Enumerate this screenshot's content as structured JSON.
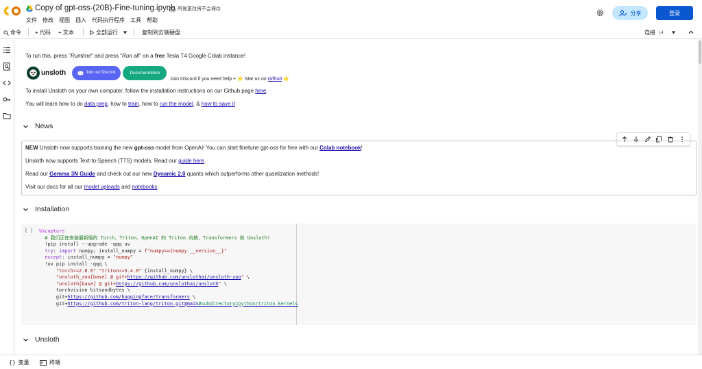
{
  "header": {
    "title": "Copy of gpt-oss-(20B)-Fine-tuning.ipynb",
    "save_note": "所做更改将不会保存",
    "menus": [
      "文件",
      "修改",
      "视图",
      "插入",
      "代码执行程序",
      "工具",
      "帮助"
    ],
    "share_label": "分享",
    "login_label": "登录"
  },
  "toolbar": {
    "command": "命令",
    "add_code": "+ 代码",
    "add_text": "+ 文本",
    "run_all": "全部运行",
    "copy_drive": "复制到云端硬盘",
    "connect": "连接",
    "runtime": "L4"
  },
  "intro": {
    "line1_pre": "To run this, press \"",
    "line1_runtime": "Runtime",
    "line1_mid": "\" and press \"",
    "line1_runall": "Run all",
    "line1_mid2": "\" on a ",
    "line1_free": "free",
    "line1_post": " Tesla T4 Google Colab instance!",
    "unsloth_logo": "unsloth",
    "discord_label": "Join our Discord",
    "docs_label": "Documentation",
    "join_pre": "Join Discord if you need help + ⭐ ",
    "star_text": "Star us on ",
    "github_link": "Github",
    "join_post": " ⭐",
    "install_pre": "To install Unsloth on your own computer, follow the installation instructions on our Github page ",
    "install_link": "here",
    "install_post": ".",
    "learn_pre": "You will learn how to do ",
    "learn_link1": "data prep",
    "learn_sep1": ", how to ",
    "learn_link2": "train",
    "learn_sep2": ", how to ",
    "learn_link3": "run the model",
    "learn_sep3": ", & ",
    "learn_link4": "how to save it"
  },
  "news": {
    "heading": "News",
    "l1_new": "NEW",
    "l1_a": " Unsloth now supports training the new ",
    "l1_model": "gpt-oss",
    "l1_b": " model from OpenAI! You can start finetune gpt-oss for free with our ",
    "l1_link": "Colab notebook",
    "l1_c": "!",
    "l2_a": "Unsloth now supports Text-to-Speech (TTS) models. Read our ",
    "l2_link": "guide here",
    "l2_b": ".",
    "l3_a": "Read our ",
    "l3_link1": "Gemma 3N Guide",
    "l3_b": " and check out our new ",
    "l3_link2": "Dynamic 2.0",
    "l3_c": " quants which outperforms other quantization methods!",
    "l4_a": "Visit our docs for all our ",
    "l4_link1": "model uploads",
    "l4_b": " and ",
    "l4_link2": "notebooks",
    "l4_c": "."
  },
  "installation": {
    "heading": "Installation",
    "run_bracket": "[ ]"
  },
  "unsloth_section": {
    "heading": "Unsloth"
  },
  "bottombar": {
    "variables": "变量",
    "terminal": "终端"
  },
  "colors": {
    "accent": "#0b57d0",
    "share_bg": "#c2e7ff",
    "discord": "#5865f2",
    "docs": "#16a881"
  }
}
